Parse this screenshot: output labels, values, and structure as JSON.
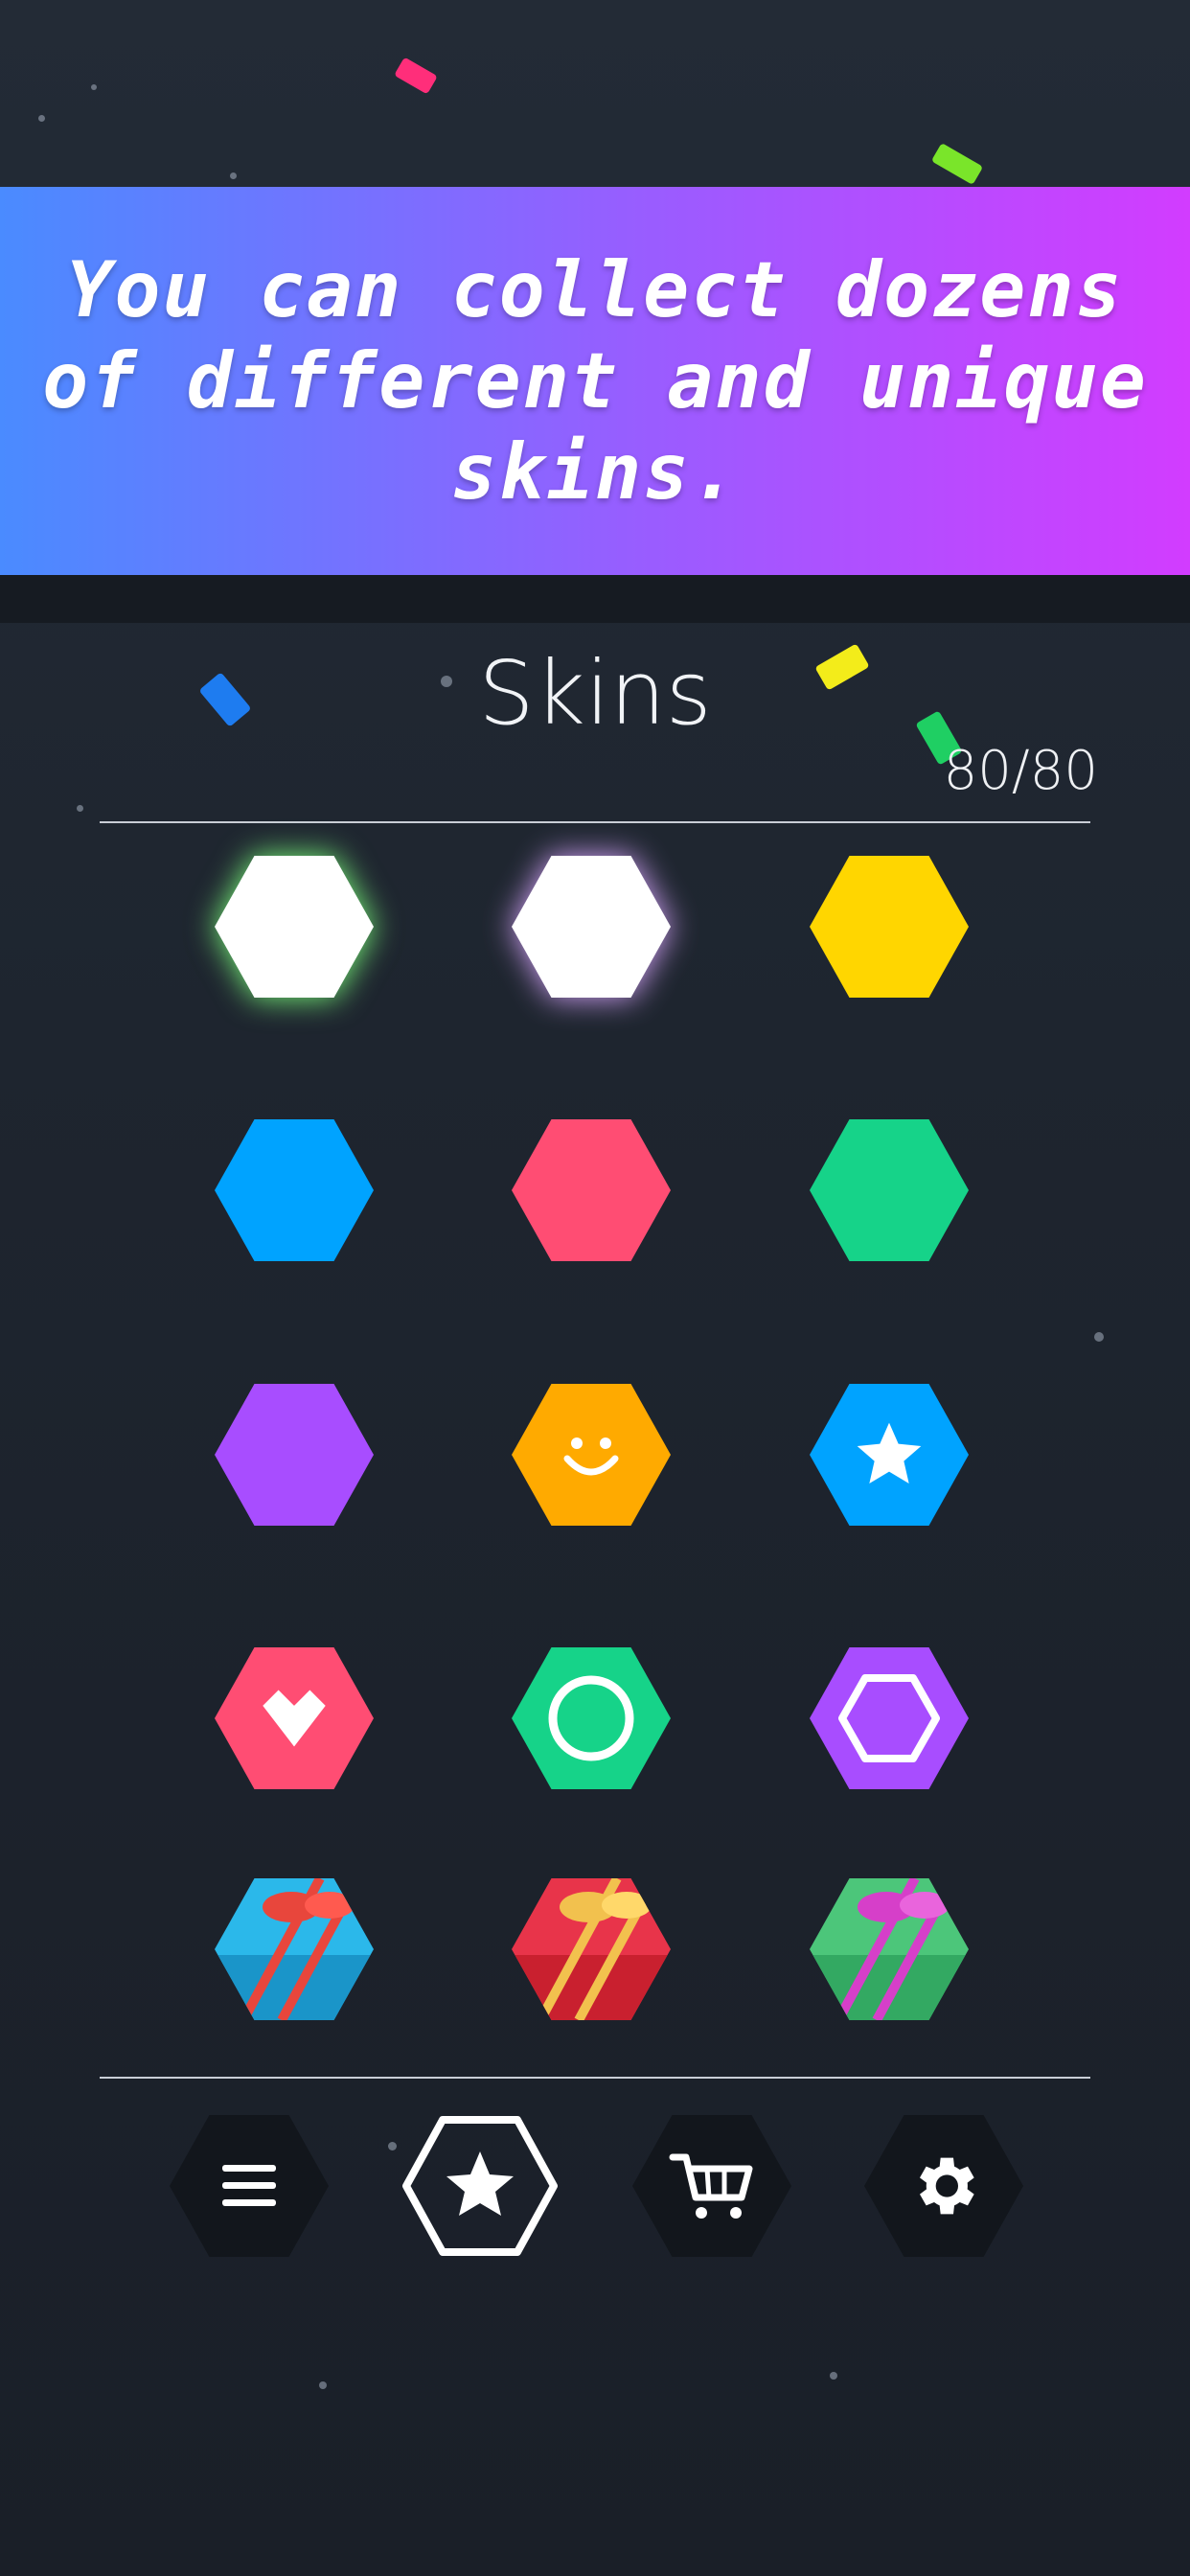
{
  "banner": {
    "text": "You can collect dozens of different and unique skins."
  },
  "screen": {
    "title": "Skins",
    "count": "80/80"
  },
  "colors": {
    "white": "#ffffff",
    "yellow": "#ffd600",
    "blue": "#00a3ff",
    "pink": "#ff4d73",
    "green": "#16d389",
    "purple": "#a84dff",
    "orange": "#ffaa00",
    "nav_bg": "#12161c"
  },
  "skins": [
    {
      "name": "white-green-glow",
      "color": "#ffffff",
      "icon": "none"
    },
    {
      "name": "white-purple-glow",
      "color": "#ffffff",
      "icon": "none"
    },
    {
      "name": "yellow",
      "color": "#ffd600",
      "icon": "none"
    },
    {
      "name": "blue",
      "color": "#00a3ff",
      "icon": "none"
    },
    {
      "name": "pink",
      "color": "#ff4d73",
      "icon": "none"
    },
    {
      "name": "green",
      "color": "#16d389",
      "icon": "none"
    },
    {
      "name": "purple",
      "color": "#a84dff",
      "icon": "none"
    },
    {
      "name": "orange-smiley",
      "color": "#ffaa00",
      "icon": "smiley-icon"
    },
    {
      "name": "blue-star",
      "color": "#00a3ff",
      "icon": "star-icon"
    },
    {
      "name": "pink-heart",
      "color": "#ff4d73",
      "icon": "heart-icon"
    },
    {
      "name": "green-ring",
      "color": "#16d389",
      "icon": "ring-icon"
    },
    {
      "name": "purple-hexring",
      "color": "#a84dff",
      "icon": "hex-ring-icon"
    },
    {
      "name": "gift-blue",
      "color": "#2bb8ea",
      "icon": "gift-icon"
    },
    {
      "name": "gift-red",
      "color": "#e8344a",
      "icon": "gift-icon"
    },
    {
      "name": "gift-green",
      "color": "#4cc67a",
      "icon": "gift-icon"
    }
  ],
  "nav": [
    {
      "name": "menu",
      "icon": "menu-icon"
    },
    {
      "name": "skins",
      "icon": "star-icon",
      "active": true
    },
    {
      "name": "shop",
      "icon": "cart-icon"
    },
    {
      "name": "settings",
      "icon": "gear-icon"
    }
  ]
}
